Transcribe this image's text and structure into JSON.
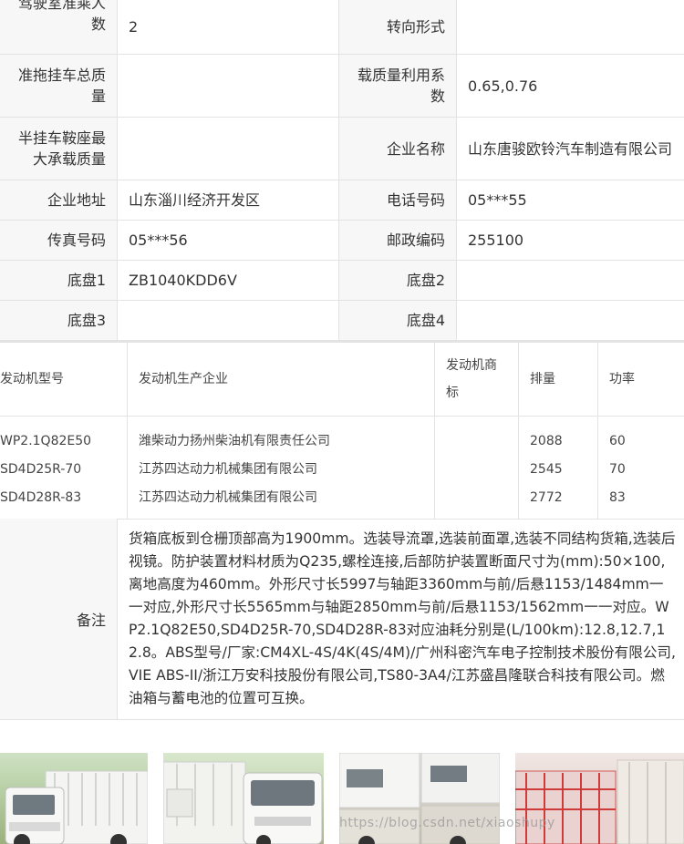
{
  "spec": {
    "rows": [
      {
        "l1": "驾驶室准乘人数",
        "v1": "2",
        "l2": "转向形式",
        "v2": ""
      },
      {
        "l1": "准拖挂车总质量",
        "v1": "",
        "l2": "载质量利用系数",
        "v2": "0.65,0.76"
      },
      {
        "l1": "半挂车鞍座最大承载质量",
        "v1": "",
        "l2": "企业名称",
        "v2": "山东唐骏欧铃汽车制造有限公司"
      },
      {
        "l1": "企业地址",
        "v1": "山东淄川经济开发区",
        "l2": "电话号码",
        "v2": "05***55"
      },
      {
        "l1": "传真号码",
        "v1": "05***56",
        "l2": "邮政编码",
        "v2": "255100"
      },
      {
        "l1": "底盘1",
        "v1": "ZB1040KDD6V",
        "l2": "底盘2",
        "v2": ""
      },
      {
        "l1": "底盘3",
        "v1": "",
        "l2": "底盘4",
        "v2": ""
      }
    ]
  },
  "engine": {
    "headers": [
      "发动机型号",
      "发动机生产企业",
      "发动机商标",
      "排量",
      "功率"
    ],
    "models": [
      "WP2.1Q82E50",
      "SD4D25R-70",
      "SD4D28R-83"
    ],
    "makers": [
      "潍柴动力扬州柴油机有限责任公司",
      "江苏四达动力机械集团有限公司",
      "江苏四达动力机械集团有限公司"
    ],
    "brands": [
      "",
      "",
      ""
    ],
    "displacements": [
      "2088",
      "2545",
      "2772"
    ],
    "powers": [
      "60",
      "70",
      "83"
    ]
  },
  "remark": {
    "label": "备注",
    "text": "货箱底板到仓栅顶部高为1900mm。选装导流罩,选装前面罩,选装不同结构货箱,选装后视镜。防护装置材料材质为Q235,螺栓连接,后部防护装置断面尺寸为(mm):50×100,离地高度为460mm。外形尺寸长5997与轴距3360mm与前/后悬1153/1484mm一一对应,外形尺寸长5565mm与轴距2850mm与前/后悬1153/1562mm一一对应。WP2.1Q82E50,SD4D25R-70,SD4D28R-83对应油耗分别是(L/100km):12.8,12.7,12.8。ABS型号/厂家:CM4XL-4S/4K(4S/4M)/广州科密汽车电子控制技术股份有限公司,VIE ABS-II/浙江万安科技股份有限公司,TS80-3A4/江苏盛昌隆联合科技有限公司。燃油箱与蓄电池的位置可互换。"
  },
  "watermark": "https://blog.csdn.net/xiaoshupy"
}
